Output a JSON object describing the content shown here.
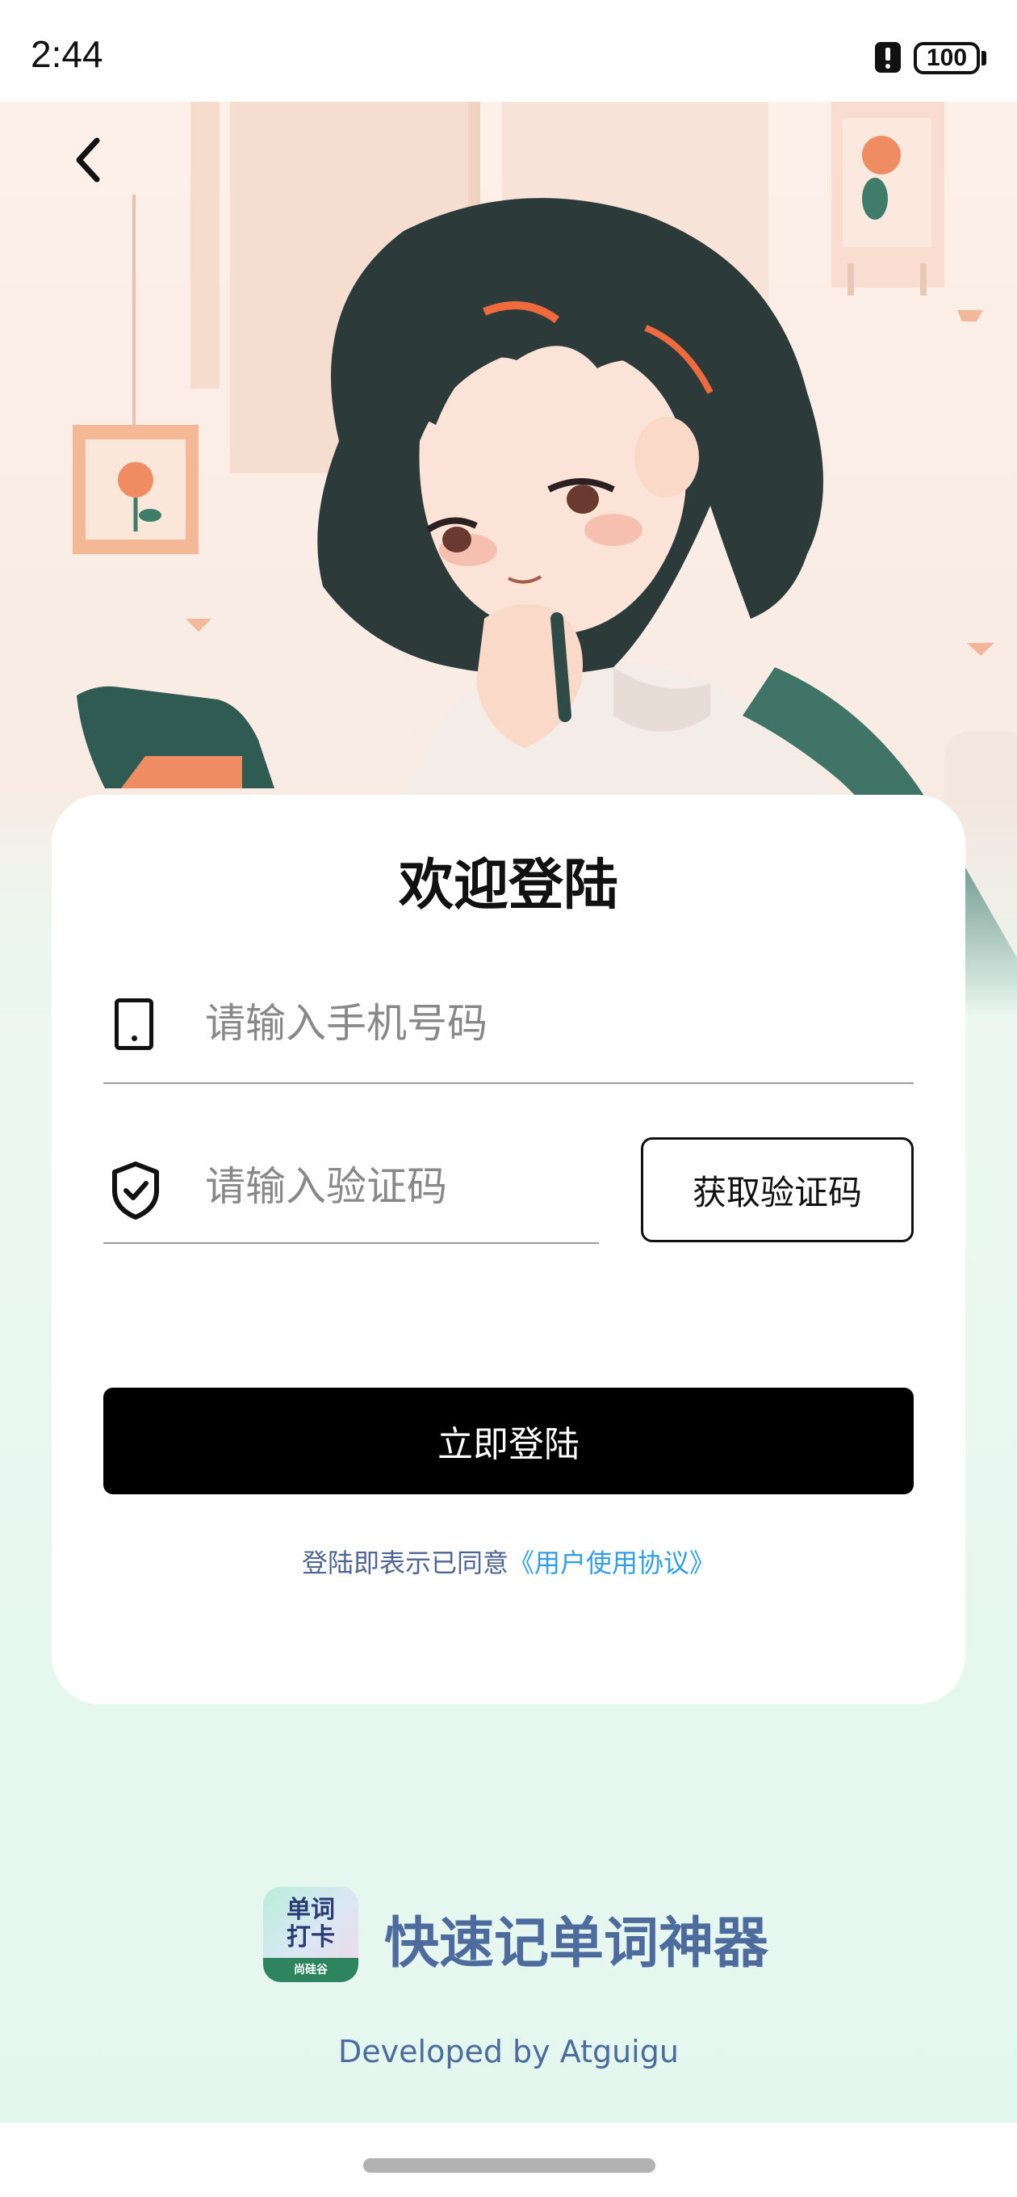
{
  "status_bar": {
    "time": "2:44",
    "battery": "100"
  },
  "login": {
    "title": "欢迎登陆",
    "phone_placeholder": "请输入手机号码",
    "phone_value": "",
    "code_placeholder": "请输入验证码",
    "code_value": "",
    "get_code_label": "获取验证码",
    "submit_label": "立即登陆",
    "agreement_prefix": "登陆即表示已同意",
    "agreement_link": "《用户使用协议》"
  },
  "branding": {
    "logo_line1": "单词",
    "logo_line2": "打卡",
    "logo_small": "尚硅谷",
    "app_name": "快速记单词神器",
    "developer": "Developed by Atguigu"
  },
  "colors": {
    "accent_link": "#2f9ee8",
    "brand_text": "#4d6b9c",
    "button_bg": "#000000"
  },
  "icons": [
    "back-chevron-icon",
    "phone-icon",
    "shield-check-icon",
    "alert-icon",
    "battery-icon"
  ]
}
